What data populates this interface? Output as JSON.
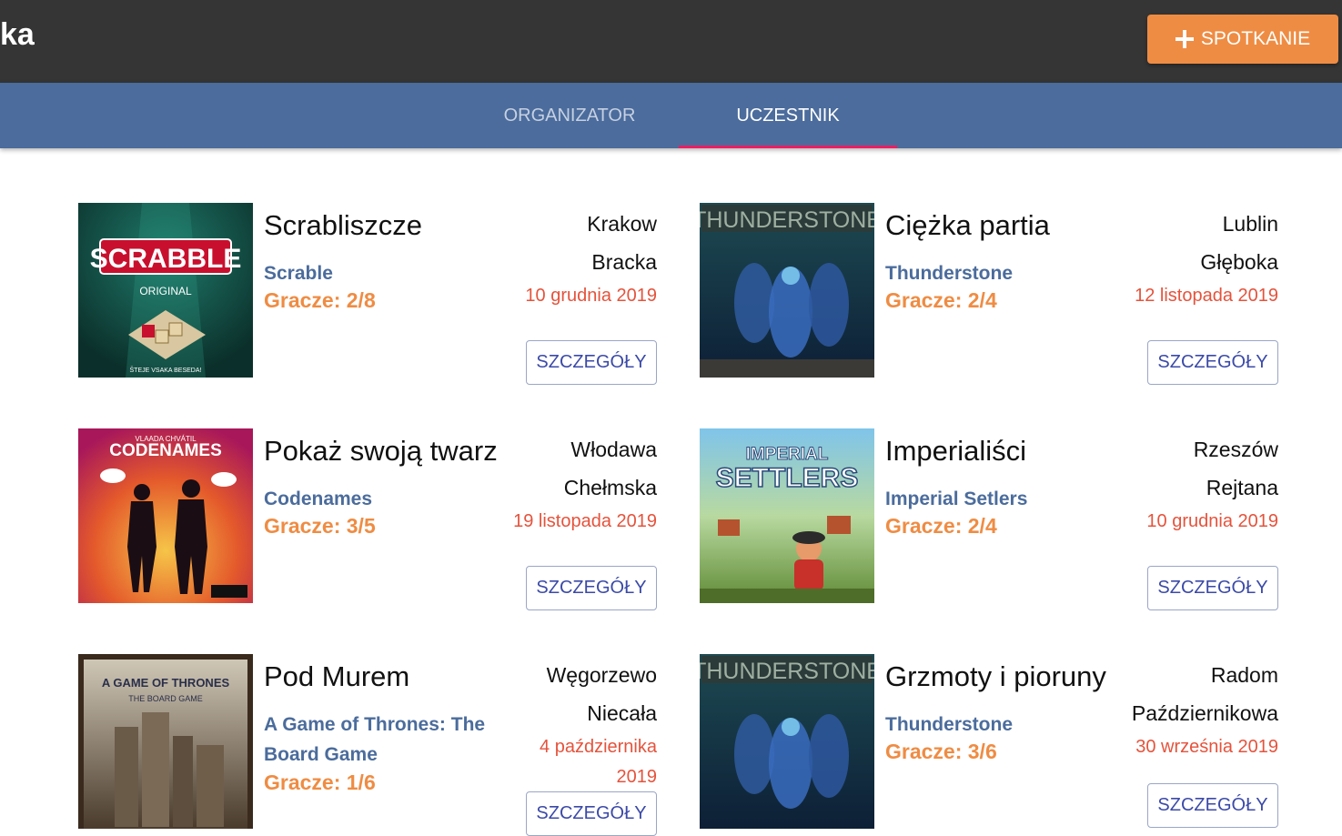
{
  "app": {
    "brand": "ka",
    "add_button_label": "SPOTKANIE"
  },
  "tabs": [
    {
      "label": "ORGANIZATOR",
      "active": false
    },
    {
      "label": "UCZESTNIK",
      "active": true
    }
  ],
  "colors": {
    "appbar": "#353535",
    "tabbar": "#4b6c9c",
    "accent": "#ef8c43",
    "tab_indicator": "#e91e63",
    "game_link": "#4b6c9c",
    "date": "#e5533c"
  },
  "meetings": [
    {
      "title": "Scrabliszcze",
      "game": "Scrable",
      "players": "Gracze: 2/8",
      "city": "Krakow",
      "street": "Bracka",
      "date": "10 grudnia 2019",
      "button": "SZCZEGÓŁY",
      "cover_icon": "scrabble-cover",
      "cover_text": "SCRABBLE",
      "cover_sub": "ORIGINAL",
      "cover_tag": "ŠTEJE VSAKA BESEDA!"
    },
    {
      "title": "Ciężka partia",
      "game": "Thunderstone",
      "players": "Gracze: 2/4",
      "city": "Lublin",
      "street": "Głęboka",
      "date": "12 listopada 2019",
      "button": "SZCZEGÓŁY",
      "cover_icon": "thunderstone-cover",
      "cover_text": "THUNDERSTONE"
    },
    {
      "title": "Pokaż swoją twarz",
      "game": "Codenames",
      "players": "Gracze: 3/5",
      "city": "Włodawa",
      "street": "Chełmska",
      "date": "19 listopada 2019",
      "button": "SZCZEGÓŁY",
      "cover_icon": "codenames-cover",
      "cover_text": "CODENAMES",
      "cover_sub": "VLAADA CHVÁTIL"
    },
    {
      "title": "Imperialiści",
      "game": "Imperial Setlers",
      "players": "Gracze: 2/4",
      "city": "Rzeszów",
      "street": "Rejtana",
      "date": "10 grudnia 2019",
      "button": "SZCZEGÓŁY",
      "cover_icon": "imperial-settlers-cover",
      "cover_text": "IMPERIAL",
      "cover_sub": "SETTLERS"
    },
    {
      "title": "Pod Murem",
      "game": "A Game of Thrones: The Board Game",
      "players": "Gracze: 1/6",
      "city": "Węgorzewo",
      "street": "Niecała",
      "date": "4 października 2019",
      "button": "SZCZEGÓŁY",
      "cover_icon": "game-of-thrones-cover",
      "cover_text": "A GAME OF THRONES",
      "cover_sub": "THE BOARD GAME"
    },
    {
      "title": "Grzmoty i pioruny",
      "game": "Thunderstone",
      "players": "Gracze: 3/6",
      "city": "Radom",
      "street": "Październikowa",
      "date": "30 września 2019",
      "button": "SZCZEGÓŁY",
      "cover_icon": "thunderstone-cover",
      "cover_text": "THUNDERSTONE"
    }
  ]
}
